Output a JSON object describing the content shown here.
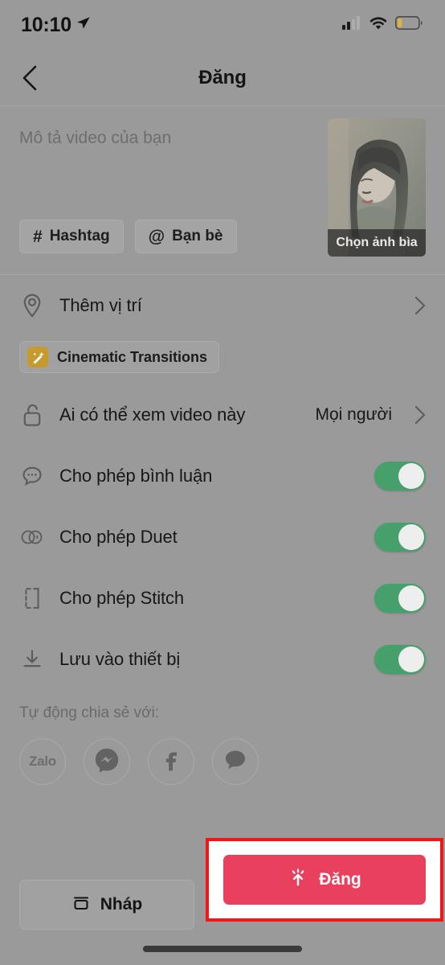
{
  "status_bar": {
    "time": "10:10",
    "location_icon": "location-arrow-icon",
    "signal_icon": "cellular-signal-icon",
    "wifi_icon": "wifi-icon",
    "battery_icon": "battery-low-icon",
    "battery_level_percent": 20,
    "battery_color": "#d8b43a"
  },
  "header": {
    "back_icon": "chevron-left-icon",
    "title": "Đăng"
  },
  "caption": {
    "placeholder": "Mô tả video của bạn",
    "value": "",
    "chips": [
      {
        "icon": "hashtag-icon",
        "glyph": "#",
        "label": "Hashtag"
      },
      {
        "icon": "at-mention-icon",
        "glyph": "@",
        "label": "Bạn bè"
      }
    ],
    "thumbnail": {
      "label": "Chọn ảnh bìa",
      "alt": "video-cover-thumbnail"
    }
  },
  "location_row": {
    "icon": "location-pin-icon",
    "label": "Thêm vị trí",
    "chevron": "chevron-right-icon"
  },
  "cinematic": {
    "icon": "magic-wand-icon",
    "label": "Cinematic Transitions",
    "icon_color": "#c79a2e"
  },
  "privacy_row": {
    "icon": "unlock-icon",
    "label": "Ai có thể xem video này",
    "value": "Mọi người",
    "chevron": "chevron-right-icon"
  },
  "toggles": [
    {
      "icon": "comment-bubble-icon",
      "label": "Cho phép bình luận",
      "on": true
    },
    {
      "icon": "duet-circles-icon",
      "label": "Cho phép Duet",
      "on": true
    },
    {
      "icon": "stitch-brackets-icon",
      "label": "Cho phép Stitch",
      "on": true
    },
    {
      "icon": "download-icon",
      "label": "Lưu vào thiết bị",
      "on": true
    }
  ],
  "share": {
    "title": "Tự động chia sẻ với:",
    "items": [
      {
        "icon": "zalo-icon",
        "label": "Zalo"
      },
      {
        "icon": "messenger-icon",
        "label": "Messenger"
      },
      {
        "icon": "facebook-icon",
        "label": "Facebook"
      },
      {
        "icon": "chat-bubble-icon",
        "label": "Tin nhắn"
      }
    ]
  },
  "bottom_bar": {
    "draft": {
      "icon": "archive-box-icon",
      "label": "Nháp"
    },
    "post": {
      "icon": "upload-burst-icon",
      "label": "Đăng",
      "color": "#e8405d"
    }
  },
  "annotation": {
    "highlight_color": "#f61515",
    "target": "post-button"
  },
  "toggle_color": "#46a06c"
}
